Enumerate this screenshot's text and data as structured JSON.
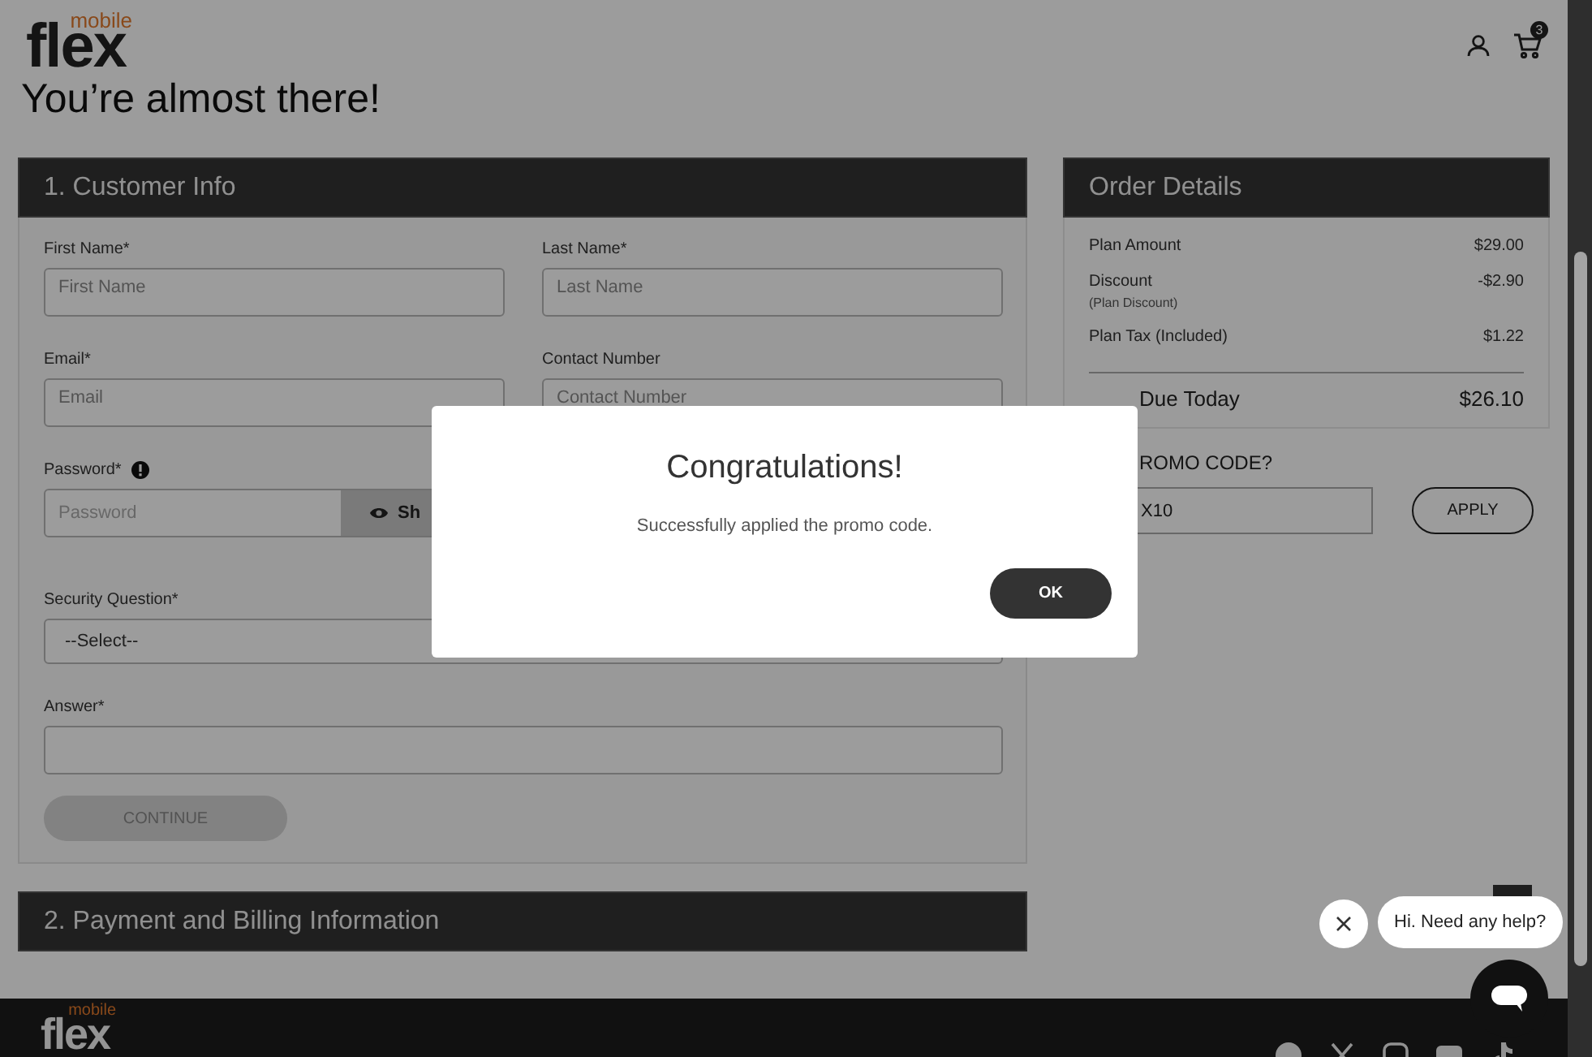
{
  "header": {
    "logo": {
      "wordmark": "flex",
      "tagline": "mobile"
    },
    "cart_count": "3"
  },
  "page_title": "You’re almost there!",
  "customer_info": {
    "title": "1. Customer Info",
    "fields": [
      {
        "label": "First Name*",
        "kind": "text",
        "placeholder": "First Name",
        "full_width": false
      },
      {
        "label": "Last Name*",
        "kind": "text",
        "placeholder": "Last Name",
        "full_width": false
      },
      {
        "label": "Email*",
        "kind": "text",
        "placeholder": "Email",
        "full_width": false
      },
      {
        "label": "Contact Number",
        "kind": "text",
        "placeholder": "Contact Number",
        "full_width": false
      },
      {
        "label": "Password*",
        "kind": "password",
        "placeholder": "Password",
        "show_button": "Sh",
        "full_width": false
      },
      {
        "label": "Security Question*",
        "kind": "select",
        "value": "--Select--",
        "full_width": true
      },
      {
        "label": "Answer*",
        "kind": "text",
        "full_width": true
      }
    ],
    "continue_button": {
      "label": "CONTINUE",
      "disabled": true
    }
  },
  "payment_section": {
    "title": "2. Payment and Billing Information"
  },
  "order_details": {
    "title": "Order Details",
    "items": [
      {
        "label": "Plan Amount",
        "amount": "$29.00"
      },
      {
        "label": "Discount",
        "note": "(Plan Discount)",
        "amount": "-$2.90"
      },
      {
        "label": "Plan Tax (Included)",
        "amount": "$1.22"
      }
    ],
    "total": {
      "label": "Due Today",
      "amount": "$26.10"
    },
    "promo": {
      "label": "ROMO CODE?",
      "value": "X10",
      "button": "APPLY"
    }
  },
  "dialog": {
    "title": "Congratulations!",
    "message": "Successfully applied the promo code.",
    "button": "OK"
  },
  "chat": {
    "greeting": "Hi. Need any help?"
  },
  "footer": {
    "logo": {
      "wordmark": "flex",
      "tagline": "mobile"
    }
  }
}
